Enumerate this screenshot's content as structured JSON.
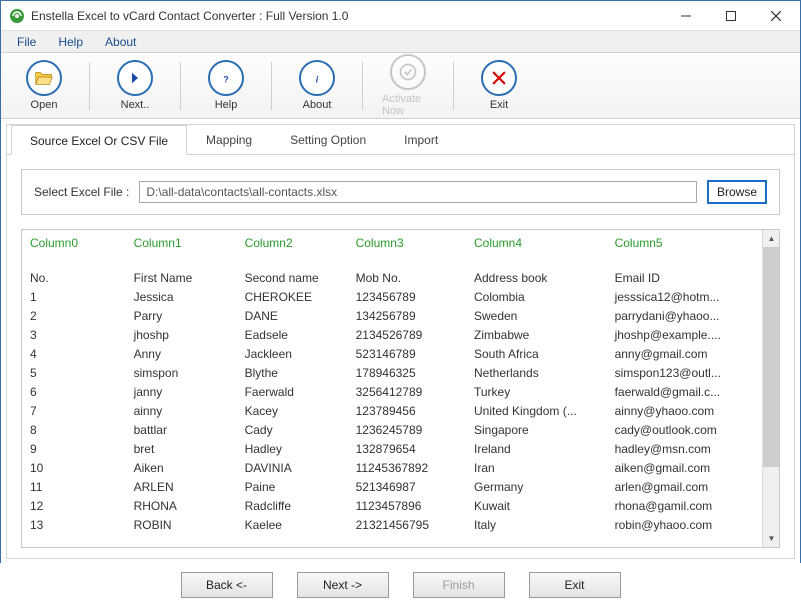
{
  "window": {
    "title": "Enstella Excel to vCard Contact Converter : Full Version 1.0"
  },
  "menu": {
    "items": [
      "File",
      "Help",
      "About"
    ]
  },
  "toolbar": {
    "open": "Open",
    "next": "Next..",
    "help": "Help",
    "about": "About",
    "activate": "Activate Now",
    "exit": "Exit"
  },
  "tabs": {
    "source": "Source Excel Or CSV File",
    "mapping": "Mapping",
    "setting": "Setting Option",
    "import": "Import"
  },
  "fileselect": {
    "label": "Select Excel File :",
    "value": "D:\\all-data\\contacts\\all-contacts.xlsx",
    "browse": "Browse"
  },
  "grid": {
    "columns": [
      "Column0",
      "Column1",
      "Column2",
      "Column3",
      "Column4",
      "Column5"
    ],
    "header_row": [
      "No.",
      "First Name",
      "Second name",
      "Mob No.",
      "Address book",
      "Email ID"
    ],
    "rows": [
      [
        "1",
        "Jessica",
        "CHEROKEE",
        "123456789",
        "Colombia",
        "jesssica12@hotm..."
      ],
      [
        "2",
        "Parry",
        "DANE",
        "134256789",
        "Sweden",
        "parrydani@yhaoo..."
      ],
      [
        "3",
        "jhoshp",
        "Eadsele",
        "2134526789",
        "Zimbabwe",
        "jhoshp@example...."
      ],
      [
        "4",
        "Anny",
        "Jackleen",
        "523146789",
        "South Africa",
        "anny@gmail.com"
      ],
      [
        "5",
        "simspon",
        "Blythe",
        "178946325",
        "Netherlands",
        "simspon123@outl..."
      ],
      [
        "6",
        "janny",
        "Faerwald",
        "3256412789",
        "Turkey",
        "faerwald@gmail.c..."
      ],
      [
        "7",
        "ainny",
        "Kacey",
        "123789456",
        "United Kingdom (...",
        "ainny@yhaoo.com"
      ],
      [
        "8",
        "battlar",
        "Cady",
        "1236245789",
        "Singapore",
        "cady@outlook.com"
      ],
      [
        "9",
        "bret",
        "Hadley",
        "132879654",
        "Ireland",
        "hadley@msn.com"
      ],
      [
        "10",
        "Aiken",
        "DAVINIA",
        "11245367892",
        "Iran",
        "aiken@gmail.com"
      ],
      [
        "11",
        "ARLEN",
        "Paine",
        "521346987",
        "Germany",
        "arlen@gmail.com"
      ],
      [
        "12",
        "RHONA",
        "Radcliffe",
        "1123457896",
        "Kuwait",
        "rhona@gamil.com"
      ],
      [
        "13",
        "ROBIN",
        "Kaelee",
        "21321456795",
        "Italy",
        "robin@yhaoo.com"
      ]
    ]
  },
  "footer": {
    "back": "Back <-",
    "next": "Next ->",
    "finish": "Finish",
    "exit": "Exit"
  }
}
